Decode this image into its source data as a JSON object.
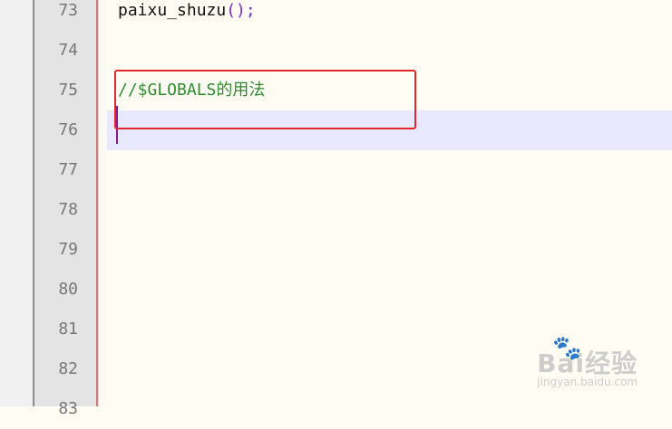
{
  "editor": {
    "lines": [
      {
        "number": "73",
        "tokens": [
          {
            "text": "paixu_shuzu",
            "kind": "fn"
          },
          {
            "text": "();",
            "kind": "punc"
          }
        ]
      },
      {
        "number": "74",
        "tokens": []
      },
      {
        "number": "75",
        "tokens": [
          {
            "text": "//$GLOBALS的用法",
            "kind": "comment"
          }
        ]
      },
      {
        "number": "76",
        "tokens": [],
        "current": true
      },
      {
        "number": "77",
        "tokens": []
      },
      {
        "number": "78",
        "tokens": []
      },
      {
        "number": "79",
        "tokens": []
      },
      {
        "number": "80",
        "tokens": []
      },
      {
        "number": "81",
        "tokens": []
      },
      {
        "number": "82",
        "tokens": []
      },
      {
        "number": "83",
        "tokens": []
      }
    ],
    "colors": {
      "background": "#fffcf4",
      "current_line": "#e8e8ff",
      "comment": "#2e8c2e",
      "punctuation": "#7a28c8",
      "highlight_box": "#e3262b"
    }
  },
  "watermark": {
    "brand": "Bai经验",
    "paw_icon": "baidu-paw-icon",
    "url": "jingyan.baidu.com"
  }
}
